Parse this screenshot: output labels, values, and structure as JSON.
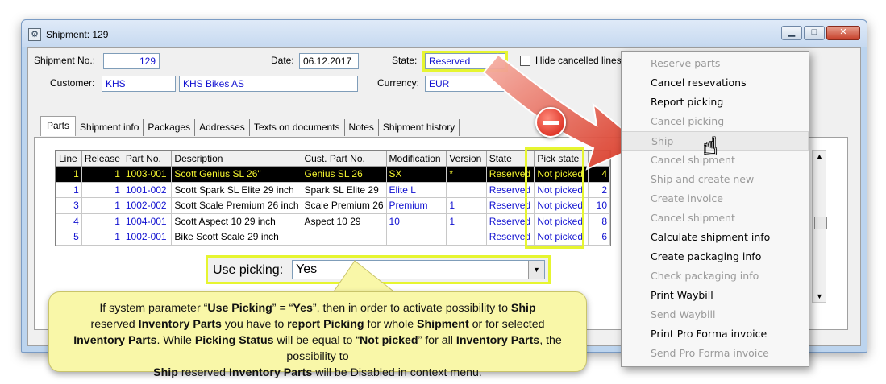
{
  "window": {
    "title": "Shipment: 129"
  },
  "header": {
    "shipment_no_label": "Shipment No.:",
    "shipment_no": "129",
    "date_label": "Date:",
    "date": "06.12.2017",
    "state_label": "State:",
    "state": "Reserved",
    "hide_cancelled_label": "Hide cancelled lines",
    "customer_label": "Customer:",
    "customer_code": "KHS",
    "customer_name": "KHS Bikes AS",
    "currency_label": "Currency:",
    "currency": "EUR"
  },
  "tabs": [
    "Parts",
    "Shipment info",
    "Packages",
    "Addresses",
    "Texts on documents",
    "Notes",
    "Shipment history"
  ],
  "grid": {
    "columns": [
      "Line",
      "Release",
      "Part No.",
      "Description",
      "Cust. Part No.",
      "Modification",
      "Version",
      "State",
      "Pick state",
      ""
    ],
    "rows": [
      [
        "1",
        "1",
        "1003-001",
        "Scott Genius SL 26\"",
        "Genius SL 26",
        "SX",
        "*",
        "Reserved",
        "Not picked",
        "4"
      ],
      [
        "1",
        "1",
        "1001-002",
        "Scott Spark SL Elite 29 inch",
        "Spark SL Elite 29",
        "Elite L",
        "",
        "Reserved",
        "Not picked",
        "2"
      ],
      [
        "3",
        "1",
        "1002-002",
        "Scott Scale Premium 26 inch",
        "Scale Premium 26",
        "Premium",
        "1",
        "Reserved",
        "Not picked",
        "10"
      ],
      [
        "4",
        "1",
        "1004-001",
        "Scott Aspect 10 29 inch",
        "Aspect 10 29",
        "10",
        "1",
        "Reserved",
        "Not picked",
        "8"
      ],
      [
        "5",
        "1",
        "1002-001",
        "Bike Scott Scale 29 inch",
        "",
        "",
        "",
        "Reserved",
        "Not picked",
        "6"
      ]
    ]
  },
  "use_picking": {
    "label": "Use picking:",
    "value": "Yes"
  },
  "callout": {
    "p1": "If system parameter “",
    "b1": "Use Picking",
    "p2": "” = “",
    "b2": "Yes",
    "p3": "”, then in order to activate possibility to ",
    "b3": "Ship",
    "p4": " reserved ",
    "b4": "Inventory Parts",
    "p5": " you have to ",
    "b5": "report Picking",
    "p6": " for whole ",
    "b6": "Shipment",
    "p7": " or for selected ",
    "b7": "Inventory Parts",
    "p8": ". While ",
    "b8": "Picking Status",
    "p9": " will be equal to “",
    "b9": "Not picked",
    "p10": "” for all ",
    "b10": "Inventory Parts",
    "p11": ", the possibility to ",
    "b11": "Ship",
    "p12": " reserved ",
    "b12": "Inventory Parts",
    "p13": " will be Disabled in context menu."
  },
  "context_menu": [
    {
      "label": "Reserve parts",
      "enabled": false
    },
    {
      "label": "Cancel resevations",
      "enabled": true
    },
    {
      "label": "Report picking",
      "enabled": true
    },
    {
      "label": "Cancel picking",
      "enabled": false
    },
    {
      "label": "Ship",
      "enabled": false
    },
    {
      "label": "Cancel shipment",
      "enabled": false
    },
    {
      "label": "Ship and create new",
      "enabled": false
    },
    {
      "label": "Create invoice",
      "enabled": false
    },
    {
      "label": "Cancel shipment",
      "enabled": false
    },
    {
      "label": "Calculate shipment info",
      "enabled": true
    },
    {
      "label": "Create packaging info",
      "enabled": true
    },
    {
      "label": "Check packaging info",
      "enabled": false
    },
    {
      "label": "Print Waybill",
      "enabled": true
    },
    {
      "label": "Send Waybill",
      "enabled": false
    },
    {
      "label": "Print Pro Forma invoice",
      "enabled": true
    },
    {
      "label": "Send Pro Forma invoice",
      "enabled": false
    }
  ],
  "colors": {
    "highlight": "#e6f530",
    "callout_bg": "#f9f7a8",
    "arrow": "#e84a3a",
    "field_text": "#1010d0"
  }
}
